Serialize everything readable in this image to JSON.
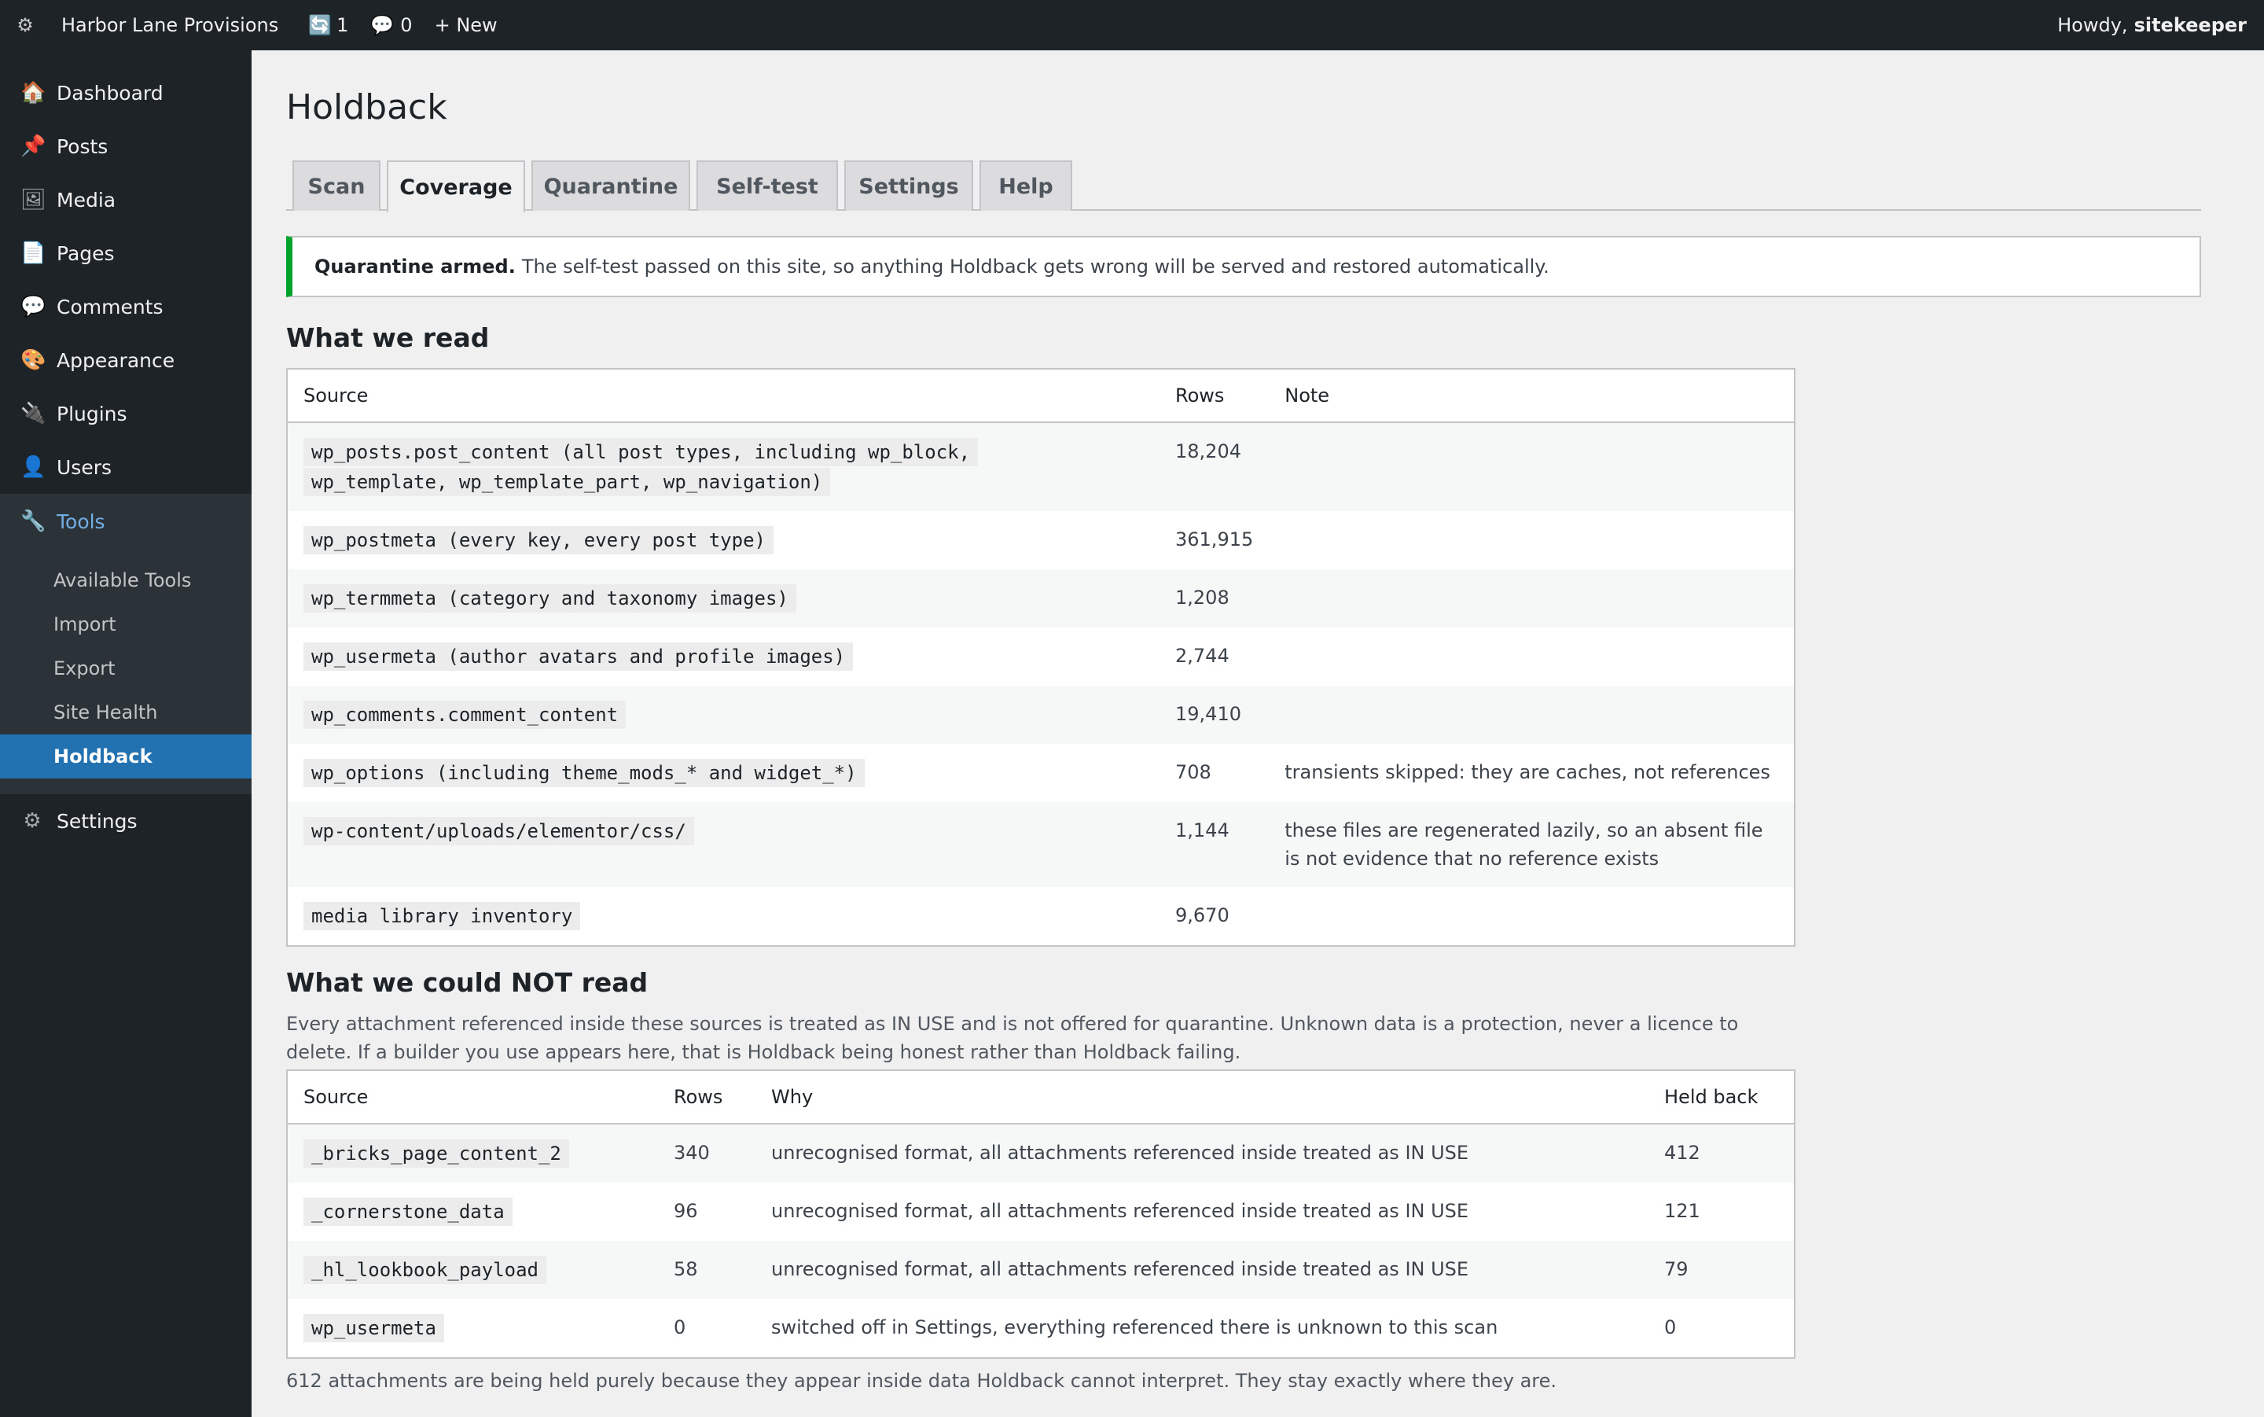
{
  "admin_bar": {
    "site_name": "Harbor Lane Provisions",
    "updates_count": "1",
    "comments_count": "0",
    "new_label": "+ New",
    "howdy_label": "Howdy,",
    "username": "sitekeeper"
  },
  "sidebar": {
    "items": [
      {
        "label": "Dashboard",
        "icon": "dashboard-icon"
      },
      {
        "label": "Posts",
        "icon": "pin-icon"
      },
      {
        "label": "Media",
        "icon": "media-icon"
      },
      {
        "label": "Pages",
        "icon": "page-icon"
      },
      {
        "label": "Comments",
        "icon": "comment-icon"
      },
      {
        "label": "Appearance",
        "icon": "palette-icon"
      },
      {
        "label": "Plugins",
        "icon": "plug-icon"
      },
      {
        "label": "Users",
        "icon": "user-icon"
      },
      {
        "label": "Tools",
        "icon": "wrench-icon"
      },
      {
        "label": "Settings",
        "icon": "gear-icon"
      }
    ],
    "tools_submenu": [
      "Available Tools",
      "Import",
      "Export",
      "Site Health",
      "Holdback"
    ]
  },
  "page": {
    "title": "Holdback",
    "tabs": [
      "Scan",
      "Coverage",
      "Quarantine",
      "Self-test",
      "Settings",
      "Help"
    ],
    "active_tab": "Coverage",
    "notice": {
      "strong": "Quarantine armed.",
      "text": "The self-test passed on this site, so anything Holdback gets wrong will be served and restored automatically."
    }
  },
  "read_section": {
    "heading": "What we read",
    "columns": [
      "Source",
      "Rows",
      "Note"
    ],
    "rows": [
      {
        "source": "wp_posts.post_content (all post types, including wp_block,",
        "source_cont": "wp_template, wp_template_part, wp_navigation)",
        "rows": "18,204",
        "note": ""
      },
      {
        "source": "wp_postmeta (every key, every post type)",
        "rows": "361,915",
        "note": ""
      },
      {
        "source": "wp_termmeta (category and taxonomy images)",
        "rows": "1,208",
        "note": ""
      },
      {
        "source": "wp_usermeta (author avatars and profile images)",
        "rows": "2,744",
        "note": ""
      },
      {
        "source": "wp_comments.comment_content",
        "rows": "19,410",
        "note": ""
      },
      {
        "source": "wp_options (including theme_mods_* and widget_*)",
        "rows": "708",
        "note": "transients skipped: they are caches, not references"
      },
      {
        "source": "wp-content/uploads/elementor/css/",
        "rows": "1,144",
        "note": "these files are regenerated lazily, so an absent file is not evidence that no reference exists"
      },
      {
        "source": "media library inventory",
        "rows": "9,670",
        "note": ""
      }
    ]
  },
  "notread_section": {
    "heading": "What we could NOT read",
    "description": "Every attachment referenced inside these sources is treated as IN USE and is not offered for quarantine. Unknown data is a protection, never a licence to delete. If a builder you use appears here, that is Holdback being honest rather than Holdback failing.",
    "columns": [
      "Source",
      "Rows",
      "Why",
      "Held back"
    ],
    "rows": [
      {
        "source": "_bricks_page_content_2",
        "rows": "340",
        "why": "unrecognised format, all attachments referenced inside treated as IN USE",
        "held": "412"
      },
      {
        "source": "_cornerstone_data",
        "rows": "96",
        "why": "unrecognised format, all attachments referenced inside treated as IN USE",
        "held": "121"
      },
      {
        "source": "_hl_lookbook_payload",
        "rows": "58",
        "why": "unrecognised format, all attachments referenced inside treated as IN USE",
        "held": "79"
      },
      {
        "source": "wp_usermeta",
        "rows": "0",
        "why": "switched off in Settings, everything referenced there is unknown to this scan",
        "held": "0"
      }
    ],
    "footnote": "612 attachments are being held purely because they appear inside data Holdback cannot interpret. They stay exactly where they are."
  },
  "colors": {
    "admin_bg": "#1d2327",
    "accent_blue": "#2271b1",
    "link_blue": "#72aee6",
    "notice_green": "#00a32a"
  }
}
